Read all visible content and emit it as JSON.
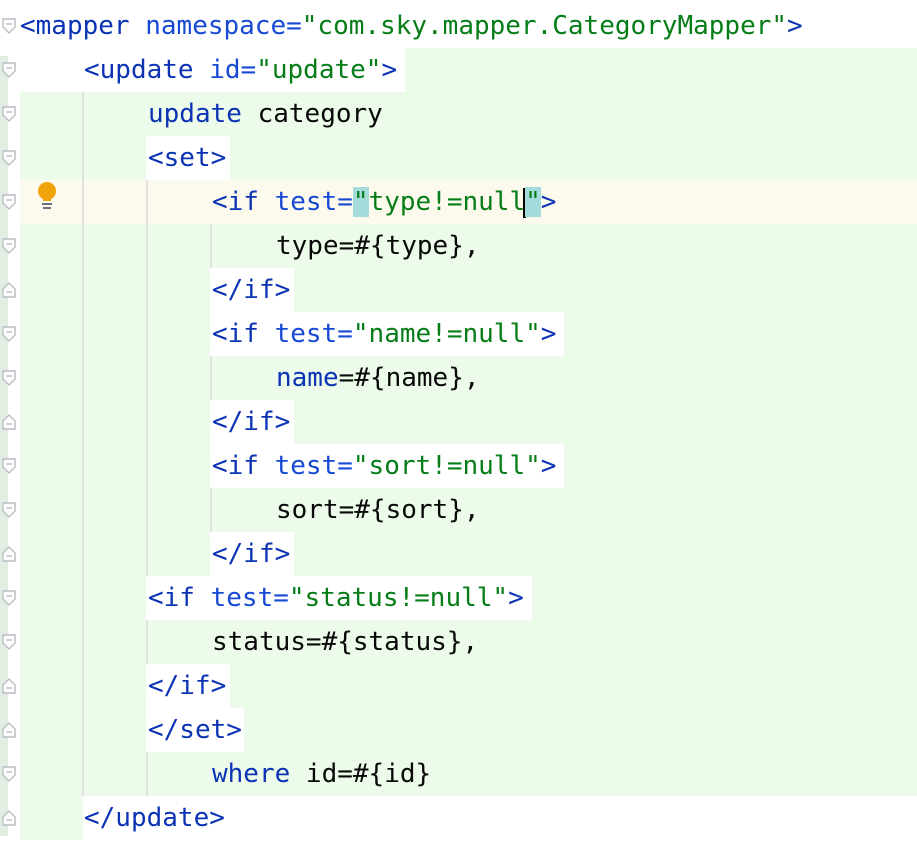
{
  "editor": {
    "lines": [
      {
        "indent": 0,
        "parts": [
          {
            "t": "<mapper",
            "c": "tag"
          },
          {
            "t": " "
          },
          {
            "t": "namespace=",
            "c": "attr"
          },
          {
            "t": "\"com.sky.mapper.CategoryMapper\"",
            "c": "str"
          },
          {
            "t": ">",
            "c": "tag"
          }
        ]
      },
      {
        "indent": 1,
        "parts": [
          {
            "t": "<update",
            "c": "tag"
          },
          {
            "t": " "
          },
          {
            "t": "id=",
            "c": "attr"
          },
          {
            "t": "\"update\"",
            "c": "str"
          },
          {
            "t": ">",
            "c": "tag"
          }
        ]
      },
      {
        "indent": 2,
        "parts": [
          {
            "t": "update",
            "c": "kw"
          },
          {
            "t": " category"
          }
        ]
      },
      {
        "indent": 2,
        "parts": [
          {
            "t": "<set>",
            "c": "tag"
          }
        ]
      },
      {
        "indent": 3,
        "parts": [
          {
            "t": "<if",
            "c": "tag"
          },
          {
            "t": " "
          },
          {
            "t": "test=",
            "c": "attr"
          },
          {
            "t": "\"",
            "c": "str hl"
          },
          {
            "t": "type!=null",
            "c": "str"
          },
          {
            "caret": true
          },
          {
            "t": "\"",
            "c": "str hl"
          },
          {
            "t": ">",
            "c": "tag"
          }
        ]
      },
      {
        "indent": 4,
        "parts": [
          {
            "t": "type=#{type},"
          }
        ]
      },
      {
        "indent": 3,
        "parts": [
          {
            "t": "</if>",
            "c": "tag"
          }
        ]
      },
      {
        "indent": 3,
        "parts": [
          {
            "t": "<if",
            "c": "tag"
          },
          {
            "t": " "
          },
          {
            "t": "test=",
            "c": "attr"
          },
          {
            "t": "\"name!=null\"",
            "c": "str"
          },
          {
            "t": ">",
            "c": "tag"
          }
        ]
      },
      {
        "indent": 4,
        "parts": [
          {
            "t": "name",
            "c": "kw"
          },
          {
            "t": "=#{name},"
          }
        ]
      },
      {
        "indent": 3,
        "parts": [
          {
            "t": "</if>",
            "c": "tag"
          }
        ]
      },
      {
        "indent": 3,
        "parts": [
          {
            "t": "<if",
            "c": "tag"
          },
          {
            "t": " "
          },
          {
            "t": "test=",
            "c": "attr"
          },
          {
            "t": "\"sort!=null\"",
            "c": "str"
          },
          {
            "t": ">",
            "c": "tag"
          }
        ]
      },
      {
        "indent": 4,
        "parts": [
          {
            "t": "sort=#{sort},"
          }
        ]
      },
      {
        "indent": 3,
        "parts": [
          {
            "t": "</if>",
            "c": "tag"
          }
        ]
      },
      {
        "indent": 2,
        "parts": [
          {
            "t": "<if",
            "c": "tag"
          },
          {
            "t": " "
          },
          {
            "t": "test=",
            "c": "attr"
          },
          {
            "t": "\"status!=null\"",
            "c": "str"
          },
          {
            "t": ">",
            "c": "tag"
          }
        ]
      },
      {
        "indent": 3,
        "parts": [
          {
            "t": "status=#{status},"
          }
        ]
      },
      {
        "indent": 2,
        "parts": [
          {
            "t": "</if>",
            "c": "tag"
          }
        ]
      },
      {
        "indent": 2,
        "parts": [
          {
            "t": "</set>",
            "c": "tag"
          }
        ]
      },
      {
        "indent": 3,
        "parts": [
          {
            "t": "where",
            "c": "kw"
          },
          {
            "t": " id=#{id}"
          }
        ]
      },
      {
        "indent": 1,
        "parts": [
          {
            "t": "</update>",
            "c": "tag"
          }
        ]
      }
    ],
    "gutter_icons": [
      "fold-icon",
      "intention-bulb-icon"
    ],
    "colors": {
      "tag": "#0b33b4",
      "attribute": "#174ad4",
      "string": "#067d17",
      "text": "#080808",
      "tag_region": "#edfbea",
      "caret_line": "#fcfaec",
      "brace_match": "#a4dcdc"
    }
  }
}
